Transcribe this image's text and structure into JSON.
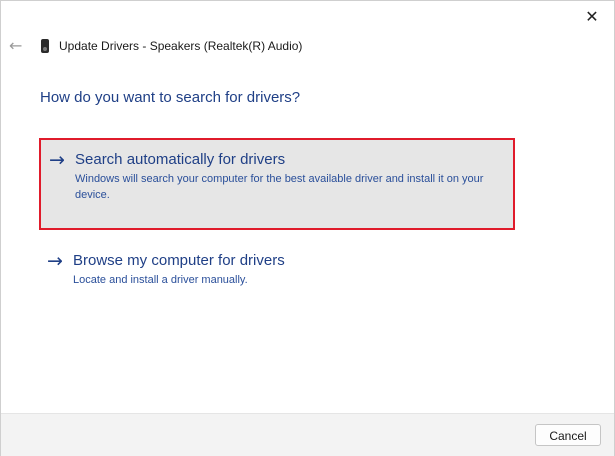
{
  "window": {
    "title": "Update Drivers - Speakers (Realtek(R) Audio)",
    "close_glyph": "✕",
    "back_glyph": "←"
  },
  "heading": "How do you want to search for drivers?",
  "options": [
    {
      "arrow": "→",
      "title": "Search automatically for drivers",
      "description": "Windows will search your computer for the best available driver and install it on your device.",
      "selected": true
    },
    {
      "arrow": "→",
      "title": "Browse my computer for drivers",
      "description": "Locate and install a driver manually.",
      "selected": false
    }
  ],
  "footer": {
    "cancel_label": "Cancel"
  },
  "colors": {
    "link_blue": "#1f3f86",
    "highlight_border": "#e01b2b",
    "highlight_bg": "#e6e6e6"
  },
  "icons": {
    "device": "speaker-device-icon",
    "back": "back-arrow-icon",
    "close": "close-icon",
    "option_arrow": "right-arrow-icon"
  }
}
